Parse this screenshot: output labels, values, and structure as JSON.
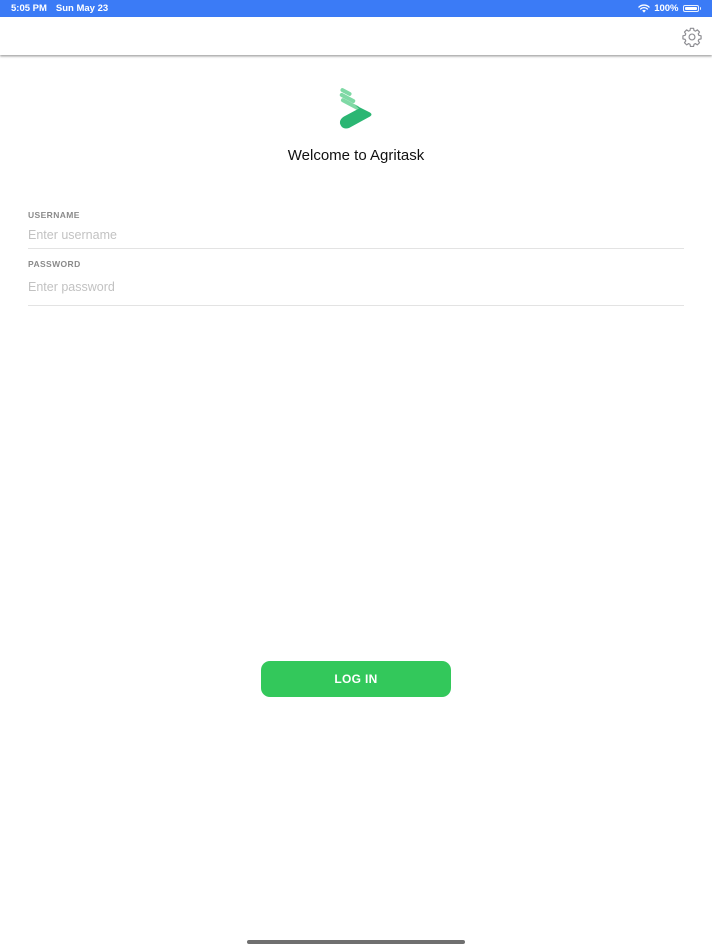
{
  "status_bar": {
    "time": "5:05 PM",
    "date": "Sun May 23",
    "battery_text": "100%",
    "battery_level": 1.0,
    "background_color": "#3b7bf6",
    "icons": [
      "wifi-icon",
      "battery-icon"
    ]
  },
  "nav_bar": {
    "settings_icon": "gear-icon"
  },
  "branding": {
    "logo": "agritask-logo",
    "logo_colors": [
      "#2bb673",
      "#7fd9a5"
    ],
    "welcome_text": "Welcome to Agritask"
  },
  "form": {
    "username": {
      "label": "USERNAME",
      "placeholder": "Enter username",
      "value": ""
    },
    "password": {
      "label": "PASSWORD",
      "placeholder": "Enter password",
      "value": ""
    }
  },
  "actions": {
    "login_label": "LOG IN",
    "login_color": "#33c85b"
  }
}
